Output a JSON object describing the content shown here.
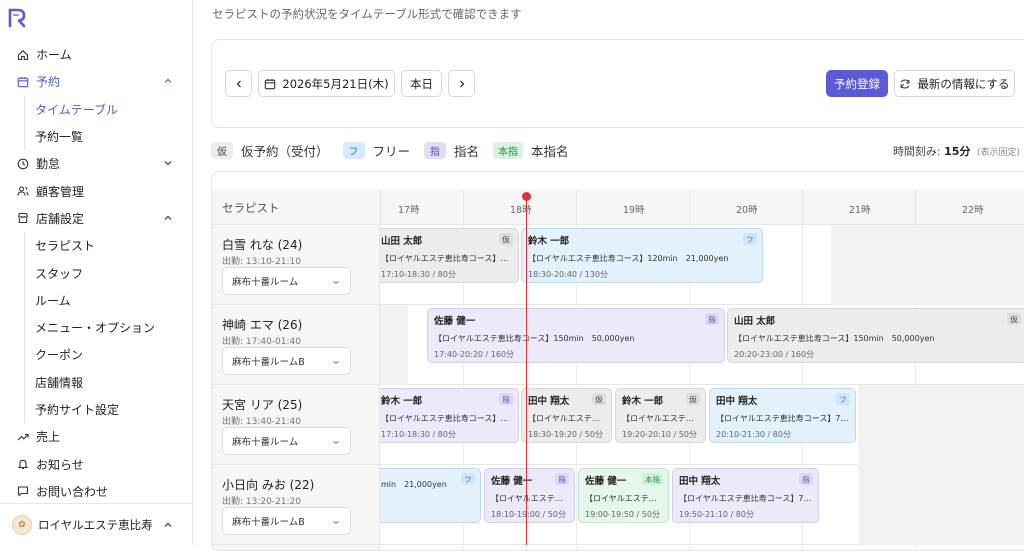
{
  "sidebar": {
    "items": [
      {
        "label": "ホーム"
      },
      {
        "label": "予約"
      },
      {
        "label": "タイムテーブル"
      },
      {
        "label": "予約一覧"
      },
      {
        "label": "勤怠"
      },
      {
        "label": "顧客管理"
      },
      {
        "label": "店舗設定"
      },
      {
        "label": "セラピスト"
      },
      {
        "label": "スタッフ"
      },
      {
        "label": "ルーム"
      },
      {
        "label": "メニュー・オプション"
      },
      {
        "label": "クーポン"
      },
      {
        "label": "店舗情報"
      },
      {
        "label": "予約サイト設定"
      },
      {
        "label": "売上"
      },
      {
        "label": "お知らせ"
      },
      {
        "label": "お問い合わせ"
      }
    ],
    "store_name": "ロイヤルエステ恵比寿"
  },
  "page": {
    "subtitle": "セラピストの予約状況をタイムテーブル形式で確認できます"
  },
  "toolbar": {
    "date": "2026年5月21日(木)",
    "today": "本日",
    "reserve": "予約登録",
    "refresh": "最新の情報にする"
  },
  "legend": [
    {
      "badge": "仮",
      "label": "仮予約（受付）"
    },
    {
      "badge": "フ",
      "label": "フリー"
    },
    {
      "badge": "指",
      "label": "指名"
    },
    {
      "badge": "本指",
      "label": "本指名"
    }
  ],
  "time_step": {
    "label": "時間刻み:",
    "value": "15分",
    "note": "(表示固定)"
  },
  "timetable": {
    "therapist_header": "セラピスト",
    "hours": [
      "17時",
      "18時",
      "19時",
      "20時",
      "21時",
      "22時"
    ],
    "therapists": [
      {
        "name": "白雪 れな (24)",
        "shift": "出勤: 13:10-21:10",
        "room": "麻布十番ルーム",
        "bookings": [
          {
            "name": "山田 太郎",
            "badge": "仮",
            "course": "【ロイヤルエステ恵比寿コース】7…",
            "time": "17:10-18:30 / 80分"
          },
          {
            "name": "鈴木 一郎",
            "badge": "フ",
            "course": "【ロイヤルエステ恵比寿コース】120min　21,000yen",
            "time": "18:30-20:40 / 130分"
          }
        ]
      },
      {
        "name": "神崎 エマ (26)",
        "shift": "出勤: 17:40-01:40",
        "room": "麻布十番ルームB",
        "bookings": [
          {
            "name": "佐藤 健一",
            "badge": "指",
            "course": "【ロイヤルエステ恵比寿コース】150min　50,000yen",
            "time": "17:40-20:20 / 160分"
          },
          {
            "name": "山田 太郎",
            "badge": "仮",
            "course": "【ロイヤルエステ恵比寿コース】150min　50,000yen",
            "time": "20:20-23:00 / 160分"
          }
        ]
      },
      {
        "name": "天宮 リア (25)",
        "shift": "出勤: 13:40-21:40",
        "room": "麻布十番ルーム",
        "bookings": [
          {
            "name": "鈴木 一郎",
            "badge": "指",
            "course": "【ロイヤルエステ恵比寿コース】7…",
            "time": "17:10-18:30 / 80分"
          },
          {
            "name": "田中 翔太",
            "badge": "仮",
            "course": "【ロイヤルエステ…",
            "time": "18:30-19:20 / 50分"
          },
          {
            "name": "鈴木 一郎",
            "badge": "仮",
            "course": "【ロイヤルエステ…",
            "time": "19:20-20:10 / 50分"
          },
          {
            "name": "田中 翔太",
            "badge": "フ",
            "course": "【ロイヤルエステ恵比寿コース】7…",
            "time": "20:10-21:30 / 80分"
          }
        ]
      },
      {
        "name": "小日向 みお (22)",
        "shift": "出勤: 13:20-21:20",
        "room": "麻布十番ルームB",
        "bookings": [
          {
            "name": "",
            "badge": "フ",
            "course": "min　21,000yen",
            "time": ""
          },
          {
            "name": "佐藤 健一",
            "badge": "指",
            "course": "【ロイヤルエステ…",
            "time": "18:10-19:00 / 50分"
          },
          {
            "name": "佐藤 健一",
            "badge": "本指",
            "course": "【ロイヤルエステ…",
            "time": "19:00-19:50 / 50分"
          },
          {
            "name": "田中 翔太",
            "badge": "指",
            "course": "【ロイヤルエステ恵比寿コース】7…",
            "time": "19:50-21:10 / 80分"
          }
        ]
      }
    ]
  },
  "colors": {
    "accent": "#5b5bd6",
    "now_line": "#d9343a",
    "kari": "#ececee",
    "free": "#e3f1fc",
    "shimei": "#ece9f8",
    "honshimei": "#e6f6ea"
  }
}
